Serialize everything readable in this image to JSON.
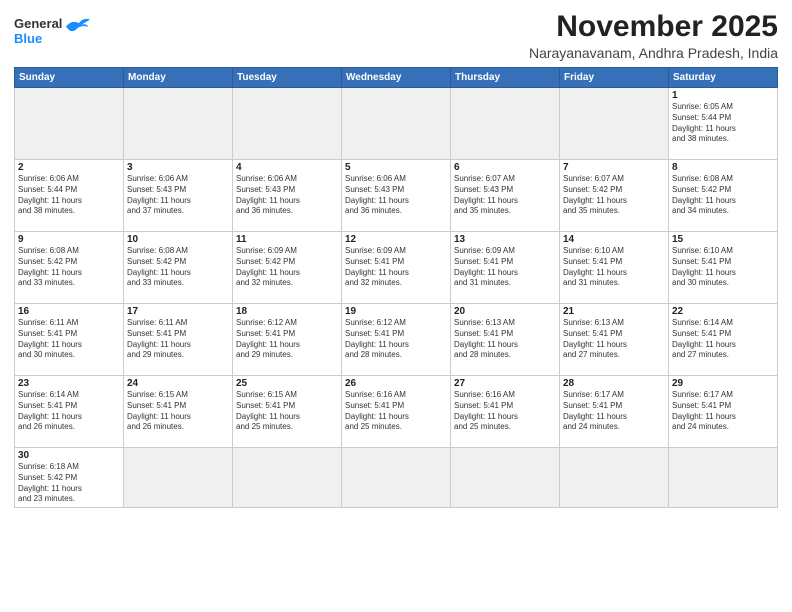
{
  "header": {
    "logo_general": "General",
    "logo_blue": "Blue",
    "month_title": "November 2025",
    "subtitle": "Narayanavanam, Andhra Pradesh, India"
  },
  "weekdays": [
    "Sunday",
    "Monday",
    "Tuesday",
    "Wednesday",
    "Thursday",
    "Friday",
    "Saturday"
  ],
  "weeks": [
    [
      {
        "day": "",
        "info": ""
      },
      {
        "day": "",
        "info": ""
      },
      {
        "day": "",
        "info": ""
      },
      {
        "day": "",
        "info": ""
      },
      {
        "day": "",
        "info": ""
      },
      {
        "day": "",
        "info": ""
      },
      {
        "day": "1",
        "info": "Sunrise: 6:05 AM\nSunset: 5:44 PM\nDaylight: 11 hours\nand 38 minutes."
      }
    ],
    [
      {
        "day": "2",
        "info": "Sunrise: 6:06 AM\nSunset: 5:44 PM\nDaylight: 11 hours\nand 38 minutes."
      },
      {
        "day": "3",
        "info": "Sunrise: 6:06 AM\nSunset: 5:43 PM\nDaylight: 11 hours\nand 37 minutes."
      },
      {
        "day": "4",
        "info": "Sunrise: 6:06 AM\nSunset: 5:43 PM\nDaylight: 11 hours\nand 36 minutes."
      },
      {
        "day": "5",
        "info": "Sunrise: 6:06 AM\nSunset: 5:43 PM\nDaylight: 11 hours\nand 36 minutes."
      },
      {
        "day": "6",
        "info": "Sunrise: 6:07 AM\nSunset: 5:43 PM\nDaylight: 11 hours\nand 35 minutes."
      },
      {
        "day": "7",
        "info": "Sunrise: 6:07 AM\nSunset: 5:42 PM\nDaylight: 11 hours\nand 35 minutes."
      },
      {
        "day": "8",
        "info": "Sunrise: 6:08 AM\nSunset: 5:42 PM\nDaylight: 11 hours\nand 34 minutes."
      }
    ],
    [
      {
        "day": "9",
        "info": "Sunrise: 6:08 AM\nSunset: 5:42 PM\nDaylight: 11 hours\nand 33 minutes."
      },
      {
        "day": "10",
        "info": "Sunrise: 6:08 AM\nSunset: 5:42 PM\nDaylight: 11 hours\nand 33 minutes."
      },
      {
        "day": "11",
        "info": "Sunrise: 6:09 AM\nSunset: 5:42 PM\nDaylight: 11 hours\nand 32 minutes."
      },
      {
        "day": "12",
        "info": "Sunrise: 6:09 AM\nSunset: 5:41 PM\nDaylight: 11 hours\nand 32 minutes."
      },
      {
        "day": "13",
        "info": "Sunrise: 6:09 AM\nSunset: 5:41 PM\nDaylight: 11 hours\nand 31 minutes."
      },
      {
        "day": "14",
        "info": "Sunrise: 6:10 AM\nSunset: 5:41 PM\nDaylight: 11 hours\nand 31 minutes."
      },
      {
        "day": "15",
        "info": "Sunrise: 6:10 AM\nSunset: 5:41 PM\nDaylight: 11 hours\nand 30 minutes."
      }
    ],
    [
      {
        "day": "16",
        "info": "Sunrise: 6:11 AM\nSunset: 5:41 PM\nDaylight: 11 hours\nand 30 minutes."
      },
      {
        "day": "17",
        "info": "Sunrise: 6:11 AM\nSunset: 5:41 PM\nDaylight: 11 hours\nand 29 minutes."
      },
      {
        "day": "18",
        "info": "Sunrise: 6:12 AM\nSunset: 5:41 PM\nDaylight: 11 hours\nand 29 minutes."
      },
      {
        "day": "19",
        "info": "Sunrise: 6:12 AM\nSunset: 5:41 PM\nDaylight: 11 hours\nand 28 minutes."
      },
      {
        "day": "20",
        "info": "Sunrise: 6:13 AM\nSunset: 5:41 PM\nDaylight: 11 hours\nand 28 minutes."
      },
      {
        "day": "21",
        "info": "Sunrise: 6:13 AM\nSunset: 5:41 PM\nDaylight: 11 hours\nand 27 minutes."
      },
      {
        "day": "22",
        "info": "Sunrise: 6:14 AM\nSunset: 5:41 PM\nDaylight: 11 hours\nand 27 minutes."
      }
    ],
    [
      {
        "day": "23",
        "info": "Sunrise: 6:14 AM\nSunset: 5:41 PM\nDaylight: 11 hours\nand 26 minutes."
      },
      {
        "day": "24",
        "info": "Sunrise: 6:15 AM\nSunset: 5:41 PM\nDaylight: 11 hours\nand 26 minutes."
      },
      {
        "day": "25",
        "info": "Sunrise: 6:15 AM\nSunset: 5:41 PM\nDaylight: 11 hours\nand 25 minutes."
      },
      {
        "day": "26",
        "info": "Sunrise: 6:16 AM\nSunset: 5:41 PM\nDaylight: 11 hours\nand 25 minutes."
      },
      {
        "day": "27",
        "info": "Sunrise: 6:16 AM\nSunset: 5:41 PM\nDaylight: 11 hours\nand 25 minutes."
      },
      {
        "day": "28",
        "info": "Sunrise: 6:17 AM\nSunset: 5:41 PM\nDaylight: 11 hours\nand 24 minutes."
      },
      {
        "day": "29",
        "info": "Sunrise: 6:17 AM\nSunset: 5:41 PM\nDaylight: 11 hours\nand 24 minutes."
      }
    ],
    [
      {
        "day": "30",
        "info": "Sunrise: 6:18 AM\nSunset: 5:42 PM\nDaylight: 11 hours\nand 23 minutes."
      },
      {
        "day": "",
        "info": ""
      },
      {
        "day": "",
        "info": ""
      },
      {
        "day": "",
        "info": ""
      },
      {
        "day": "",
        "info": ""
      },
      {
        "day": "",
        "info": ""
      },
      {
        "day": "",
        "info": ""
      }
    ]
  ]
}
